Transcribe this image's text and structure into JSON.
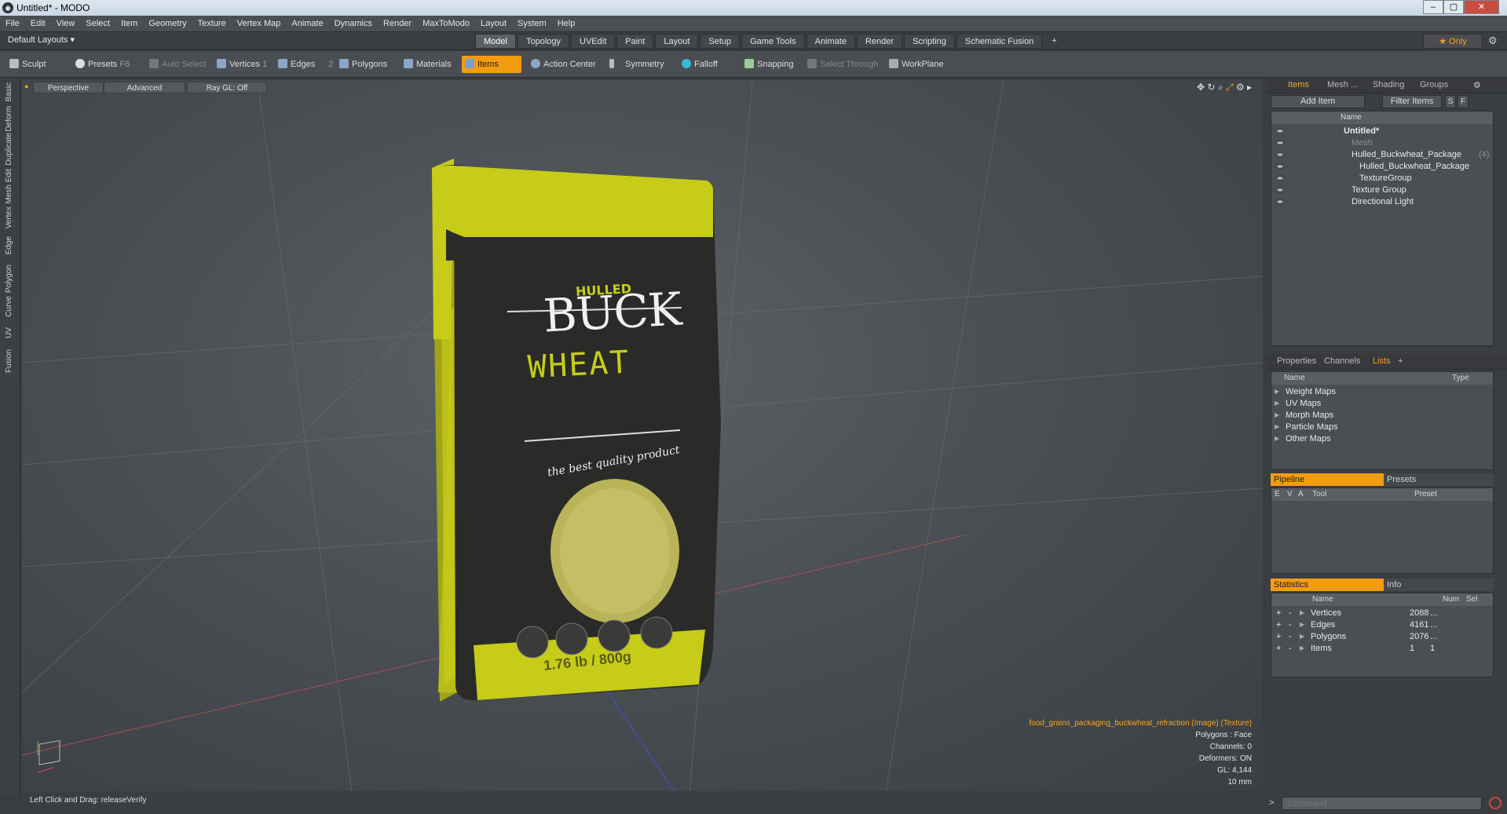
{
  "window": {
    "title": "Untitled* - MODO",
    "icon": "modo-logo-icon"
  },
  "menu": [
    "File",
    "Edit",
    "View",
    "Select",
    "Item",
    "Geometry",
    "Texture",
    "Vertex Map",
    "Animate",
    "Dynamics",
    "Render",
    "MaxToModo",
    "Layout",
    "System",
    "Help"
  ],
  "layouts": {
    "label": "Default Layouts ▾",
    "tabs": [
      "Model",
      "Topology",
      "UVEdit",
      "Paint",
      "Layout",
      "Setup",
      "Game Tools",
      "Animate",
      "Render",
      "Scripting",
      "Schematic Fusion"
    ],
    "active": "Model",
    "add": "+",
    "only": "★ Only"
  },
  "toolbar": {
    "sculpt": "Sculpt",
    "presets": "Presets",
    "presets_key": "F6",
    "auto_select": "Auto Select",
    "vertices": "Vertices",
    "vertices_n": "1",
    "edges": "Edges",
    "edges_n": "2",
    "polygons": "Polygons",
    "materials": "Materials",
    "items": "Items",
    "action_center": "Action Center",
    "symmetry": "Symmetry",
    "falloff": "Falloff",
    "snapping": "Snapping",
    "select_through": "Select Through",
    "workplane": "WorkPlane"
  },
  "left_tabs": [
    "Basic",
    "Deform",
    "Duplicate",
    "Mesh Edit",
    "Vertex",
    "Edge",
    "Polygon",
    "Curve",
    "UV",
    "Fusion"
  ],
  "viewport": {
    "view": "Perspective",
    "advanced": "Advanced",
    "raygl": "Ray GL: Off",
    "info": {
      "texture": "food_grains_packaging_buckwheat_refraction (Image) (Texture)",
      "polygons": "Polygons : Face",
      "channels": "Channels: 0",
      "deformers": "Deformers: ON",
      "gl": "GL: 4,144",
      "scale": "10 mm"
    },
    "package": {
      "hulled": "HULLED",
      "buck": "BUCK",
      "wheat": "WHEAT",
      "tagline": "the best quality product",
      "weight": "1.76 lb / 800g"
    }
  },
  "items_panel": {
    "tabs": [
      "Items",
      "Mesh ...",
      "Shading",
      "Groups"
    ],
    "active": "Items",
    "add_item": "Add Item",
    "filter": "Filter Items",
    "s": "S",
    "f": "F",
    "col_name": "Name",
    "tree": [
      {
        "label": "Untitled*",
        "bold": true
      },
      {
        "label": "Mesh",
        "dim": true
      },
      {
        "label": "Hulled_Buckwheat_Package",
        "extra": "(4)"
      },
      {
        "label": "Hulled_Buckwheat_Package"
      },
      {
        "label": "TextureGroup"
      },
      {
        "label": "Texture Group"
      },
      {
        "label": "Directional Light"
      }
    ]
  },
  "lists_panel": {
    "tabs": [
      "Properties",
      "Channels",
      "Lists"
    ],
    "active": "Lists",
    "add": "+",
    "col_name": "Name",
    "col_type": "Type",
    "items": [
      "Weight Maps",
      "UV Maps",
      "Morph Maps",
      "Particle Maps",
      "Other Maps"
    ]
  },
  "pipeline": {
    "tab": "Pipeline",
    "presets": "Presets",
    "cols": [
      "E",
      "V",
      "A",
      "Tool",
      "Preset"
    ]
  },
  "stats": {
    "tab": "Statistics",
    "info": "Info",
    "col_name": "Name",
    "col_num": "Num",
    "col_sel": "Sel",
    "rows": [
      {
        "name": "Vertices",
        "num": "2088",
        "sel": "..."
      },
      {
        "name": "Edges",
        "num": "4161",
        "sel": "..."
      },
      {
        "name": "Polygons",
        "num": "2076",
        "sel": "..."
      },
      {
        "name": "Items",
        "num": "1",
        "sel": "1"
      }
    ]
  },
  "status": {
    "text": "Left Click and Drag:  releaseVerify"
  },
  "command": {
    "placeholder": "Command"
  }
}
